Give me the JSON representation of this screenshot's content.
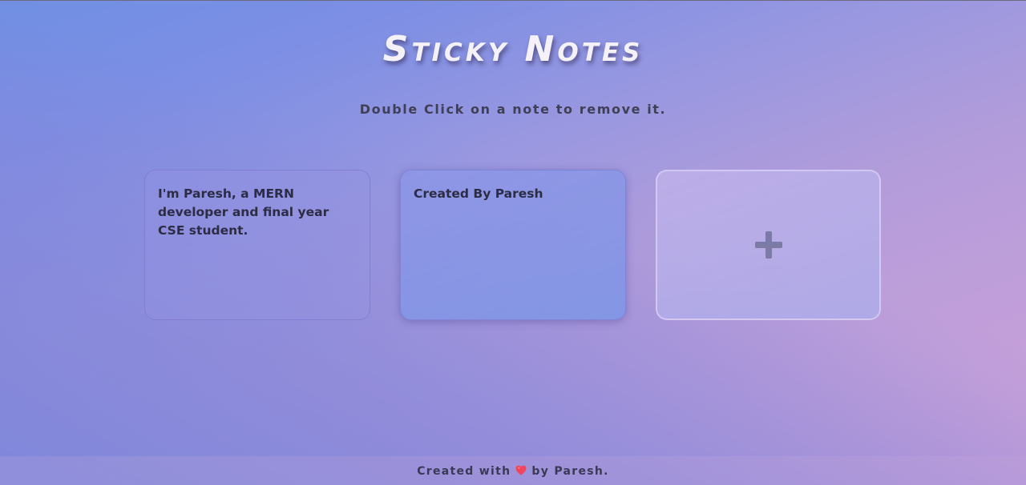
{
  "header": {
    "title": "Sticky Notes",
    "subtitle": "Double Click on a note to remove it."
  },
  "notes": [
    {
      "text": "I'm Paresh, a MERN developer and final year CSE student."
    },
    {
      "text": "Created By Paresh"
    }
  ],
  "add_button": {
    "icon": "plus-icon",
    "symbol": "+"
  },
  "footer": {
    "prefix": "Created with",
    "icon": "heart-icon",
    "suffix": "by Paresh."
  },
  "colors": {
    "accent_heart": "#f0455a",
    "text_dark": "#2c2c44",
    "title_text": "#f4f2f8"
  }
}
